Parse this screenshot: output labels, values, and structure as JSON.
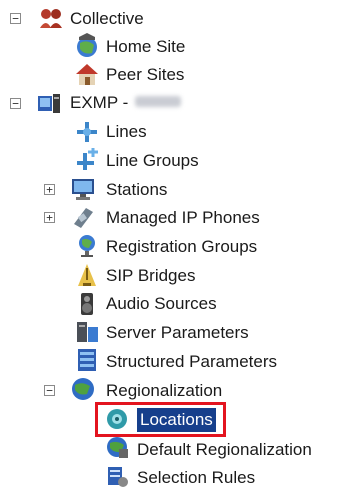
{
  "tree": {
    "collective": {
      "label": "Collective",
      "toggle": "⊟"
    },
    "home_site": {
      "label": "Home Site"
    },
    "peer_sites": {
      "label": "Peer Sites"
    },
    "exmp": {
      "label": "EXMP -",
      "toggle": "⊟"
    },
    "lines": {
      "label": "Lines"
    },
    "line_groups": {
      "label": "Line Groups"
    },
    "stations": {
      "label": "Stations",
      "toggle": "⊞"
    },
    "managed_ip_phones": {
      "label": "Managed IP Phones",
      "toggle": "⊞"
    },
    "registration_groups": {
      "label": "Registration Groups"
    },
    "sip_bridges": {
      "label": "SIP Bridges"
    },
    "audio_sources": {
      "label": "Audio Sources"
    },
    "server_parameters": {
      "label": "Server Parameters"
    },
    "structured_parameters": {
      "label": "Structured Parameters"
    },
    "regionalization": {
      "label": "Regionalization",
      "toggle": "⊟"
    },
    "locations": {
      "label": "Locations",
      "selected": true
    },
    "default_regionalization": {
      "label": "Default Regionalization"
    },
    "selection_rules": {
      "label": "Selection Rules"
    }
  },
  "colors": {
    "selection": "#163f8c",
    "highlight_box": "#e3141f"
  },
  "icons": [
    "people-group-icon",
    "globe-home-icon",
    "house-icon",
    "server-icon",
    "line-icon",
    "line-group-icon",
    "monitor-icon",
    "ip-phone-icon",
    "registration-globe-icon",
    "sip-bridge-icon",
    "speaker-icon",
    "server-parameters-icon",
    "structured-parameters-icon",
    "globe-icon",
    "location-globe-icon",
    "default-region-icon",
    "selection-rules-icon"
  ]
}
